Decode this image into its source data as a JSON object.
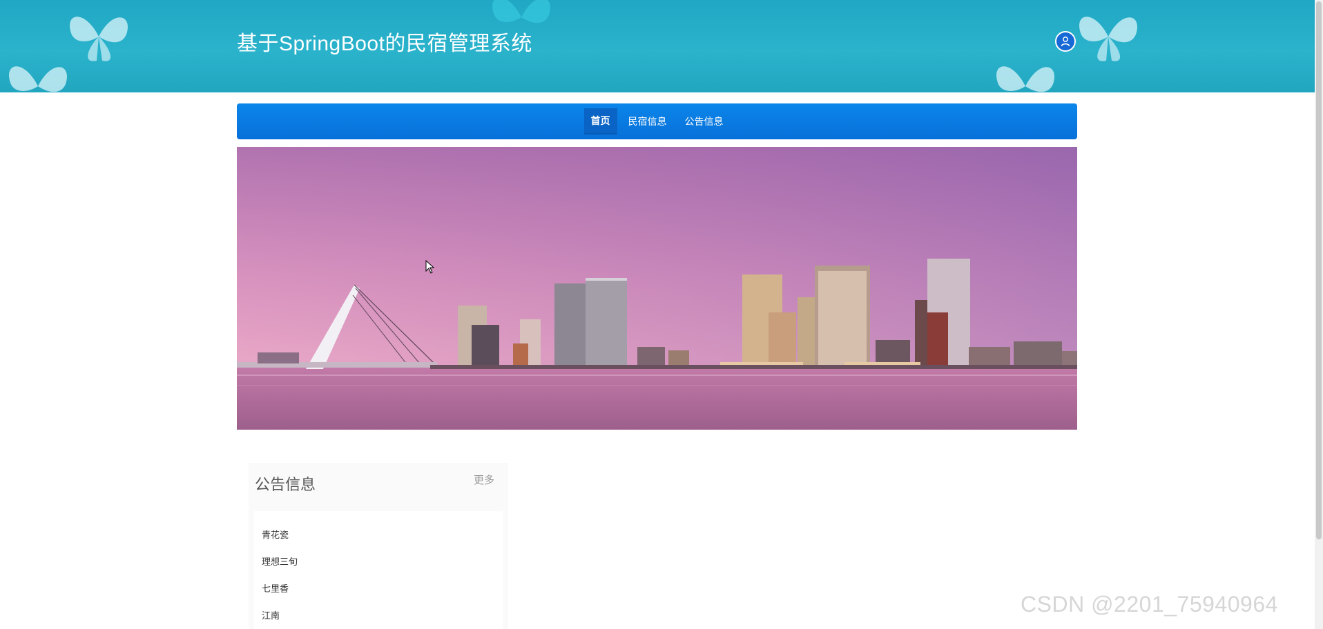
{
  "header": {
    "title": "基于SpringBoot的民宿管理系统",
    "avatar_icon": "user-avatar-icon",
    "background_color": "#22a6c0"
  },
  "nav": {
    "items": [
      {
        "label": "首页",
        "active": true
      },
      {
        "label": "民宿信息",
        "active": false
      },
      {
        "label": "公告信息",
        "active": false
      }
    ],
    "background_color": "#0770d9"
  },
  "banner": {
    "description_icon": "city-skyline-banner-image"
  },
  "notice": {
    "title": "公告信息",
    "more_label": "更多",
    "items": [
      "青花瓷",
      "理想三旬",
      "七里香",
      "江南"
    ]
  },
  "watermark": {
    "text": "CSDN @2201_75940964"
  }
}
